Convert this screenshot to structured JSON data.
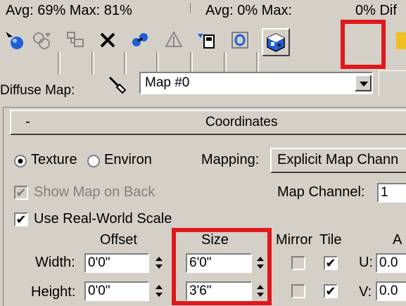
{
  "stats": {
    "left": "Avg:  69% Max:  81%",
    "mid": "Avg:    0% Max:",
    "right": "0% Dif"
  },
  "toolbar": {
    "icons": [
      "pick-material-icon",
      "put-to-scene-icon",
      "assign-material-icon",
      "delete-icon",
      "make-unique-icon",
      "put-to-library-icon",
      "material-id-icon",
      "show-map-icon",
      "show-end-result-icon",
      "go-to-parent-icon"
    ]
  },
  "diffuse": {
    "label": "Diffuse Map:",
    "map_name": "Map #0"
  },
  "rollout": {
    "minus": "-",
    "title": "Coordinates"
  },
  "coords": {
    "texture_label": "Texture",
    "environ_label": "Environ",
    "mapping_label": "Mapping:",
    "mapping_value": "Explicit Map Chann",
    "show_map_back": "Show Map on Back",
    "map_channel_label": "Map Channel:",
    "map_channel_value": "1",
    "real_world": "Use Real-World Scale",
    "col_offset": "Offset",
    "col_size": "Size",
    "col_mirror": "Mirror",
    "col_tile": "Tile",
    "col_angle": "A",
    "width_label": "Width:",
    "height_label": "Height:",
    "width_offset": "0'0\"",
    "height_offset": "0'0\"",
    "width_size": "6'0\"",
    "height_size": "3'6\"",
    "u_label": "U:",
    "v_label": "V:",
    "u_value": "0.0",
    "v_value": "0.0"
  },
  "colors": {
    "highlight": "#e0181c",
    "panel": "#d4d0c8"
  }
}
